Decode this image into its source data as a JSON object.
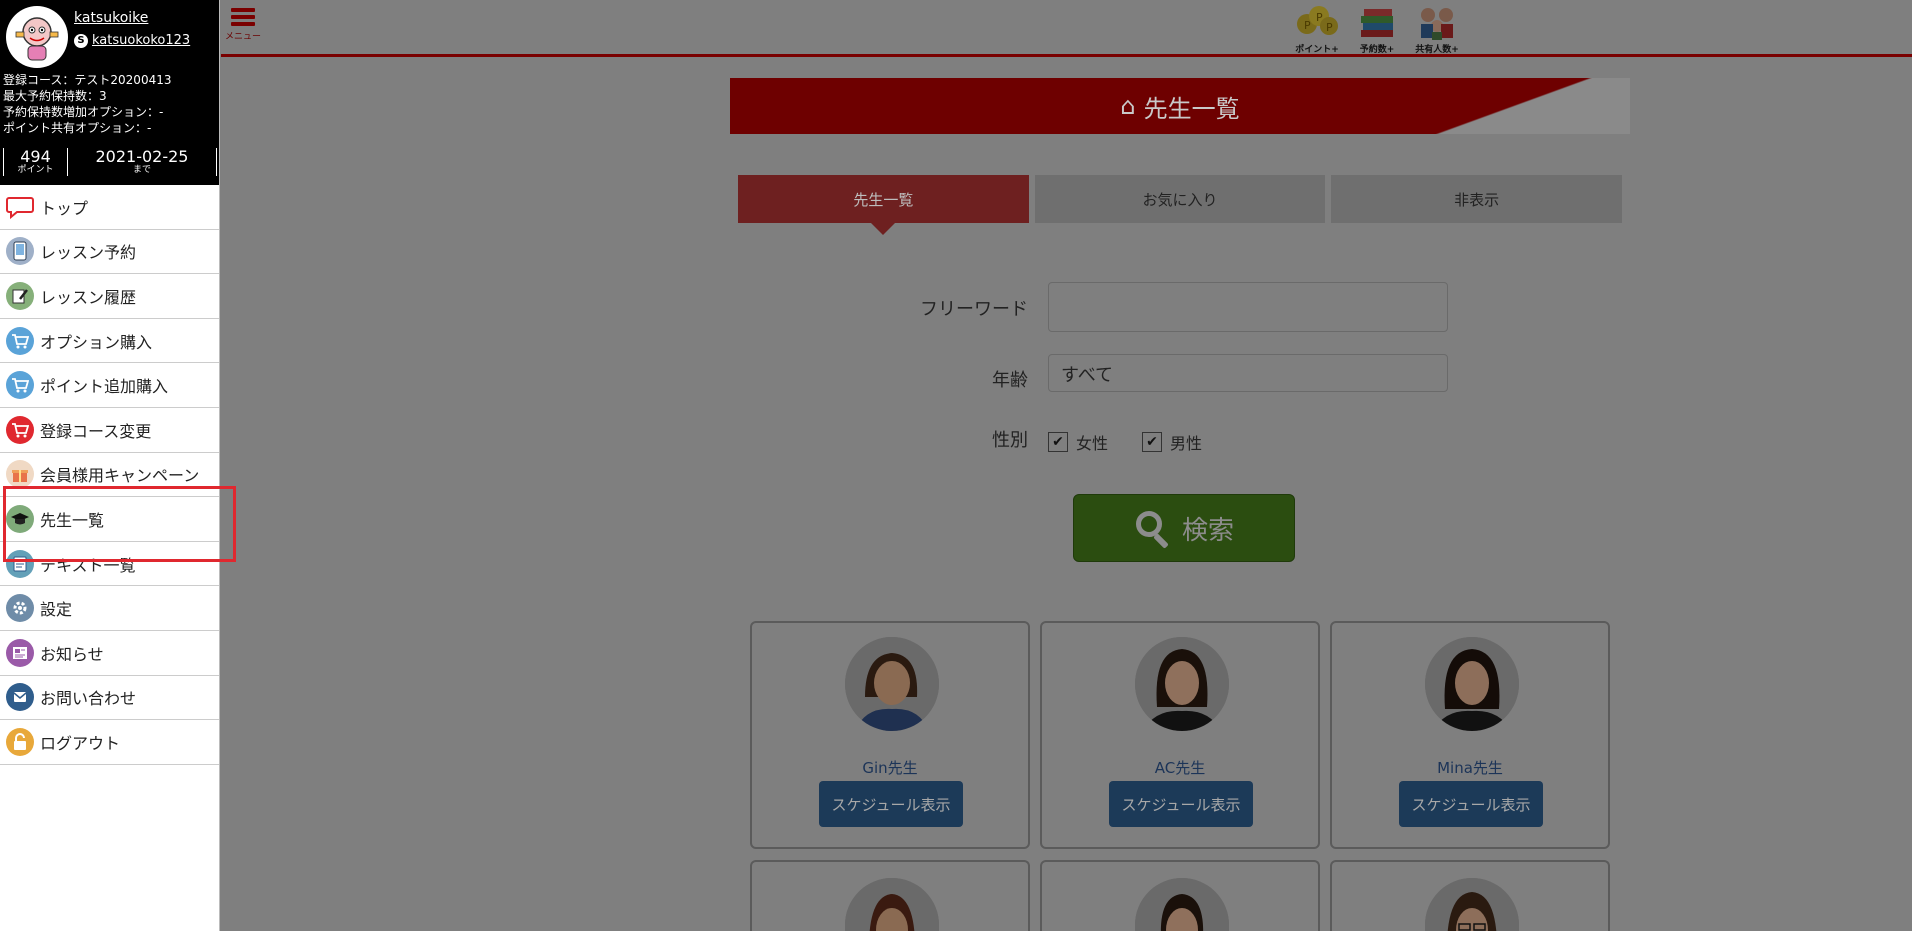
{
  "sidebar": {
    "profile": {
      "username": "katsukoike",
      "skype_id": "katsuokoko123",
      "info_lines": [
        "登録コース：テスト20200413",
        "最大予約保持数：3",
        "予約保持数増加オプション：-",
        "ポイント共有オプション：-"
      ],
      "points": "494",
      "points_sub": "ポイント",
      "expiry_date": "2021-02-25",
      "expiry_sub": "まで"
    },
    "menu": [
      {
        "label": "トップ",
        "icon": "speech-bubble-icon",
        "color": "#e0282f"
      },
      {
        "label": "レッスン予約",
        "icon": "phone-icon",
        "color": "#9fb0c8"
      },
      {
        "label": "レッスン履歴",
        "icon": "pen-icon",
        "color": "#86b07a"
      },
      {
        "label": "オプション購入",
        "icon": "cart-icon",
        "color": "#5aa3d8"
      },
      {
        "label": "ポイント追加購入",
        "icon": "cart-icon",
        "color": "#5aa3d8"
      },
      {
        "label": "登録コース変更",
        "icon": "cart-icon",
        "color": "#e0282f"
      },
      {
        "label": "会員様用キャンペーン",
        "icon": "gift-icon",
        "color": "#e8a46a"
      },
      {
        "label": "先生一覧",
        "icon": "graduation-cap-icon",
        "color": "#7faa7a"
      },
      {
        "label": "テキスト一覧",
        "icon": "book-icon",
        "color": "#63a0b8"
      },
      {
        "label": "設定",
        "icon": "gear-icon",
        "color": "#6f8ca8"
      },
      {
        "label": "お知らせ",
        "icon": "news-icon",
        "color": "#9a5aa8"
      },
      {
        "label": "お問い合わせ",
        "icon": "mail-icon",
        "color": "#2f5d8c"
      },
      {
        "label": "ログアウト",
        "icon": "lock-icon",
        "color": "#e8a83a"
      }
    ]
  },
  "topbar": {
    "menu_label": "メニュー",
    "icons": [
      {
        "label": "ポイント+",
        "icon": "points-icon"
      },
      {
        "label": "予約数+",
        "icon": "books-icon"
      },
      {
        "label": "共有人数+",
        "icon": "family-icon"
      }
    ]
  },
  "main": {
    "title": "先生一覧",
    "tabs": [
      "先生一覧",
      "お気に入り",
      "非表示"
    ],
    "active_tab": "先生一覧",
    "form": {
      "keyword_label": "フリーワード",
      "keyword_value": "",
      "age_label": "年齢",
      "age_value": "すべて",
      "gender_label": "性別",
      "female_label": "女性",
      "female_checked": true,
      "male_label": "男性",
      "male_checked": true,
      "search_label": "検索"
    },
    "teachers": [
      {
        "name": "Gin先生",
        "button": "スケジュール表示"
      },
      {
        "name": "AC先生",
        "button": "スケジュール表示"
      },
      {
        "name": "Mina先生",
        "button": "スケジュール表示"
      }
    ]
  },
  "colors": {
    "brand_red": "#c00000",
    "highlight": "#e0282f",
    "search_green": "#559b2b",
    "schedule_blue": "#3b7bc0",
    "overlay": "#7f7f7f"
  }
}
